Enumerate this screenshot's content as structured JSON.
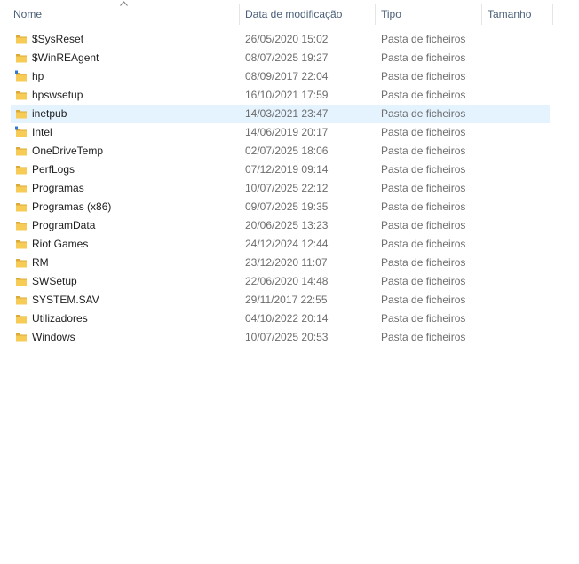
{
  "columns": {
    "name": "Nome",
    "date": "Data de modificação",
    "type": "Tipo",
    "size": "Tamanho"
  },
  "sort": {
    "column": "name",
    "direction": "ascending",
    "icon": "sort-up-arrow-icon"
  },
  "colors": {
    "header_text": "#4c607a",
    "selected_row": "#e5f3ff",
    "folder_yellow": "#f6cb56",
    "folder_dark": "#dcab3a",
    "shortcut_blue": "#2f7ad6"
  },
  "files": [
    {
      "name": "$SysReset",
      "date": "26/05/2020 15:02",
      "type": "Pasta de ficheiros",
      "size": "",
      "icon": "folder-icon",
      "selected": false
    },
    {
      "name": "$WinREAgent",
      "date": "08/07/2025 19:27",
      "type": "Pasta de ficheiros",
      "size": "",
      "icon": "folder-icon",
      "selected": false
    },
    {
      "name": "hp",
      "date": "08/09/2017 22:04",
      "type": "Pasta de ficheiros",
      "size": "",
      "icon": "folder-shared-icon",
      "selected": false
    },
    {
      "name": "hpswsetup",
      "date": "16/10/2021 17:59",
      "type": "Pasta de ficheiros",
      "size": "",
      "icon": "folder-icon",
      "selected": false
    },
    {
      "name": "inetpub",
      "date": "14/03/2021 23:47",
      "type": "Pasta de ficheiros",
      "size": "",
      "icon": "folder-icon",
      "selected": true
    },
    {
      "name": "Intel",
      "date": "14/06/2019 20:17",
      "type": "Pasta de ficheiros",
      "size": "",
      "icon": "folder-shared-icon",
      "selected": false
    },
    {
      "name": "OneDriveTemp",
      "date": "02/07/2025 18:06",
      "type": "Pasta de ficheiros",
      "size": "",
      "icon": "folder-icon",
      "selected": false
    },
    {
      "name": "PerfLogs",
      "date": "07/12/2019 09:14",
      "type": "Pasta de ficheiros",
      "size": "",
      "icon": "folder-icon",
      "selected": false
    },
    {
      "name": "Programas",
      "date": "10/07/2025 22:12",
      "type": "Pasta de ficheiros",
      "size": "",
      "icon": "folder-icon",
      "selected": false
    },
    {
      "name": "Programas (x86)",
      "date": "09/07/2025 19:35",
      "type": "Pasta de ficheiros",
      "size": "",
      "icon": "folder-icon",
      "selected": false
    },
    {
      "name": "ProgramData",
      "date": "20/06/2025 13:23",
      "type": "Pasta de ficheiros",
      "size": "",
      "icon": "folder-icon",
      "selected": false
    },
    {
      "name": "Riot Games",
      "date": "24/12/2024 12:44",
      "type": "Pasta de ficheiros",
      "size": "",
      "icon": "folder-icon",
      "selected": false
    },
    {
      "name": "RM",
      "date": "23/12/2020 11:07",
      "type": "Pasta de ficheiros",
      "size": "",
      "icon": "folder-icon",
      "selected": false
    },
    {
      "name": "SWSetup",
      "date": "22/06/2020 14:48",
      "type": "Pasta de ficheiros",
      "size": "",
      "icon": "folder-icon",
      "selected": false
    },
    {
      "name": "SYSTEM.SAV",
      "date": "29/11/2017 22:55",
      "type": "Pasta de ficheiros",
      "size": "",
      "icon": "folder-icon",
      "selected": false
    },
    {
      "name": "Utilizadores",
      "date": "04/10/2022 20:14",
      "type": "Pasta de ficheiros",
      "size": "",
      "icon": "folder-icon",
      "selected": false
    },
    {
      "name": "Windows",
      "date": "10/07/2025 20:53",
      "type": "Pasta de ficheiros",
      "size": "",
      "icon": "folder-icon",
      "selected": false
    }
  ]
}
